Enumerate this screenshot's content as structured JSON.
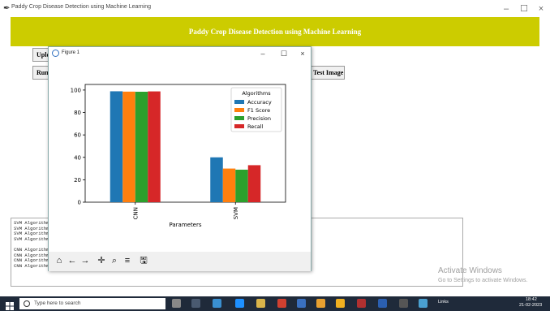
{
  "window": {
    "title": "Paddy Crop Disease Detection using Machine Learning",
    "banner": "Paddy Crop Disease Detection using Machine Learning",
    "controls": {
      "minimize": "–",
      "maximize": "☐",
      "close": "×"
    }
  },
  "buttons": {
    "upload": "Upload",
    "run": "Run C",
    "test_image": "Test Image"
  },
  "output_lines": [
    "SVM Algorithm",
    "SVM Algorithm",
    "SVM Algorithm",
    "SVM Algorithm",
    "",
    "CNN Algorithm",
    "CNN Algorithm",
    "CNN Algorithm Recall    : 98.78101109889073",
    "CNN Algorithm FSCORE    : 98.57678411283179"
  ],
  "watermark": {
    "title": "Activate Windows",
    "subtitle": "Go to Settings to activate Windows."
  },
  "figure": {
    "title": "Figure 1",
    "controls": {
      "minimize": "–",
      "maximize": "☐",
      "close": "×"
    },
    "toolbar_icons": [
      "home-icon",
      "back-icon",
      "forward-icon",
      "pan-icon",
      "zoom-icon",
      "configure-icon",
      "save-icon"
    ]
  },
  "chart_data": {
    "type": "bar",
    "categories": [
      "CNN",
      "SVM"
    ],
    "series": [
      {
        "name": "Accuracy",
        "color": "#1f77b4",
        "values": [
          98.9,
          40
        ]
      },
      {
        "name": "F1 Score",
        "color": "#ff7f0e",
        "values": [
          98.6,
          30
        ]
      },
      {
        "name": "Precision",
        "color": "#2ca02c",
        "values": [
          98.5,
          29
        ]
      },
      {
        "name": "Recall",
        "color": "#d62728",
        "values": [
          98.8,
          33
        ]
      }
    ],
    "title": "",
    "xlabel": "Parameters",
    "ylabel": "",
    "ylim": [
      0,
      105
    ],
    "yticks": [
      0,
      20,
      40,
      60,
      80,
      100
    ],
    "legend_title": "Algorithms",
    "legend_position": "top-right",
    "grid": false
  },
  "taskbar": {
    "search_placeholder": "Type here to search",
    "links": "Links",
    "time": "18:42",
    "date": "21-02-2023"
  }
}
